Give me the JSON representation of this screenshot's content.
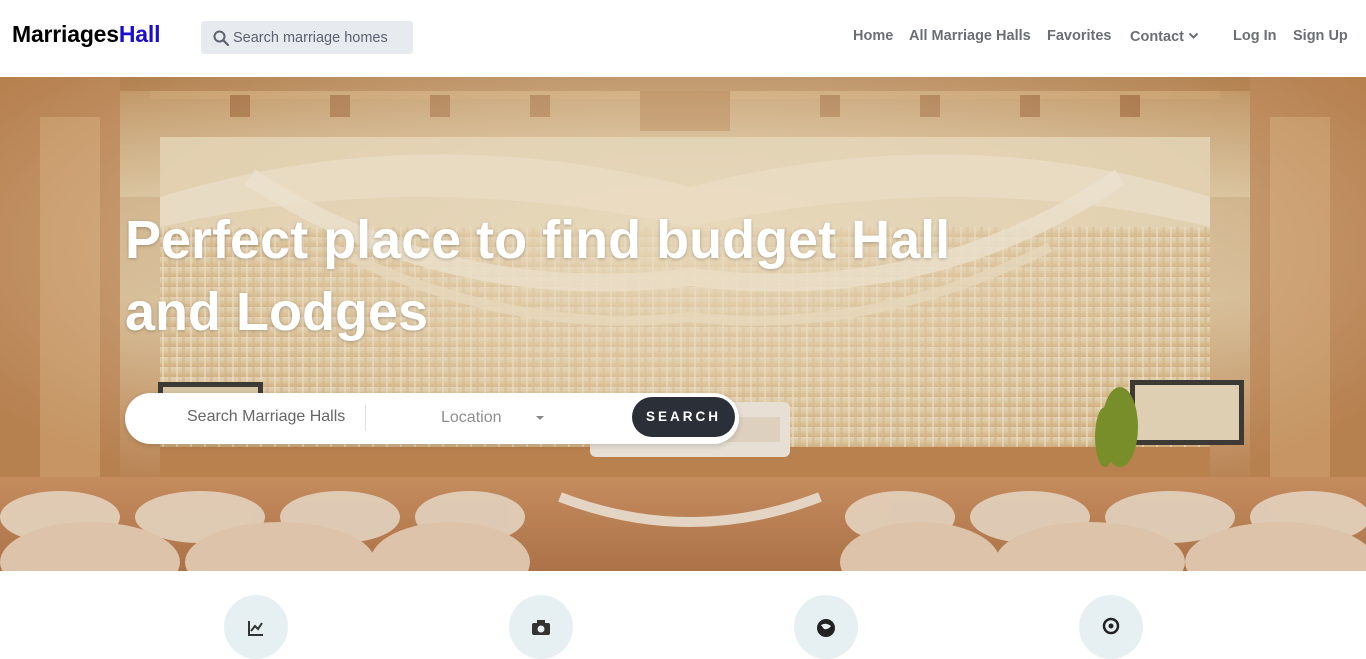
{
  "brand": {
    "part1": "Marriages",
    "part2": "Hall",
    "accent_color": "#1a0dcc"
  },
  "nav_search": {
    "placeholder": "Search marriage homes",
    "icon": "search-icon"
  },
  "nav": {
    "home": "Home",
    "all_halls": "All Marriage Halls",
    "favorites": "Favorites",
    "contact": "Contact",
    "login": "Log In",
    "signup": "Sign Up"
  },
  "hero": {
    "title_line1": "Perfect place to find budget Hall",
    "title_line2": "and Lodges",
    "search_placeholder": "Search Marriage Halls",
    "location_label": "Location",
    "search_button": "SEARCH",
    "button_color": "#2b3038"
  },
  "features": {
    "icons": [
      "chart-icon",
      "camera-icon",
      "globe-icon",
      "location-icon"
    ],
    "circle_color": "#e6f0f2"
  }
}
